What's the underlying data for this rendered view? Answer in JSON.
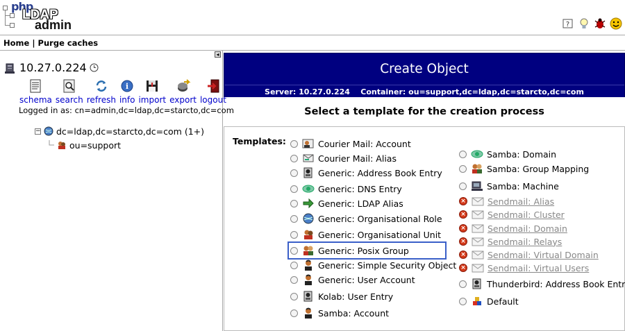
{
  "header": {
    "logo": {
      "php": "php",
      "ldap": "LDAP",
      "admin": "admin"
    },
    "icons": [
      "help-icon",
      "lightbulb-icon",
      "bug-icon",
      "smiley-icon"
    ]
  },
  "menubar": {
    "home": "Home",
    "separator": "|",
    "purge": "Purge caches"
  },
  "left": {
    "collapse_glyph": "◂",
    "server": "10.27.0.224",
    "tools": [
      {
        "label": "schema"
      },
      {
        "label": "search"
      },
      {
        "label": "refresh"
      },
      {
        "label": "info"
      },
      {
        "label": "import"
      },
      {
        "label": "export"
      },
      {
        "label": "logout"
      }
    ],
    "logged_in": "Logged in as: cn=admin,dc=ldap,dc=starcto,dc=com",
    "tree": {
      "toggle": "−",
      "root": "dc=ldap,dc=starcto,dc=com (1+)",
      "child": "ou=support"
    }
  },
  "main": {
    "title": "Create Object",
    "server_label": "Server:",
    "server": "10.27.0.224",
    "container_label": "Container:",
    "container": "ou=support,dc=ldap,dc=starcto,dc=com",
    "select_prompt": "Select a template for the creation process",
    "templates_label": "Templates:",
    "col1": [
      {
        "label": "Courier Mail: Account",
        "icon": "mail-user-icon",
        "disabled": false
      },
      {
        "label": "Courier Mail: Alias",
        "icon": "mail-alias-icon",
        "disabled": false
      },
      {
        "label": "Generic: Address Book Entry",
        "icon": "address-book-icon",
        "disabled": false
      },
      {
        "label": "Generic: DNS Entry",
        "icon": "dns-icon",
        "disabled": false
      },
      {
        "label": "Generic: LDAP Alias",
        "icon": "arrow-right-icon",
        "disabled": false
      },
      {
        "label": "Generic: Organisational Role",
        "icon": "globe-icon",
        "disabled": false
      },
      {
        "label": "Generic: Organisational Unit",
        "icon": "ou-icon",
        "disabled": false
      },
      {
        "label": "Generic: Posix Group",
        "icon": "group-icon",
        "disabled": false
      },
      {
        "label": "Generic: Simple Security Object",
        "icon": "user-icon",
        "disabled": false
      },
      {
        "label": "Generic: User Account",
        "icon": "user-icon",
        "disabled": false
      },
      {
        "label": "Kolab: User Entry",
        "icon": "address-book-icon",
        "disabled": false
      },
      {
        "label": "Samba: Account",
        "icon": "user-icon",
        "disabled": false
      }
    ],
    "col2": [
      {
        "label": "Samba: Domain",
        "icon": "dns-icon",
        "disabled": false
      },
      {
        "label": "Samba: Group Mapping",
        "icon": "group-icon",
        "disabled": false
      },
      {
        "label": "Samba: Machine",
        "icon": "computer-icon",
        "disabled": false
      },
      {
        "label": "Sendmail: Alias",
        "icon": "envelope-icon",
        "disabled": true
      },
      {
        "label": "Sendmail: Cluster",
        "icon": "envelope-icon",
        "disabled": true
      },
      {
        "label": "Sendmail: Domain",
        "icon": "envelope-icon",
        "disabled": true
      },
      {
        "label": "Sendmail: Relays",
        "icon": "envelope-icon",
        "disabled": true
      },
      {
        "label": "Sendmail: Virtual Domain",
        "icon": "envelope-icon",
        "disabled": true
      },
      {
        "label": "Sendmail: Virtual Users",
        "icon": "envelope-icon",
        "disabled": true
      },
      {
        "label": "Thunderbird: Address Book Entry",
        "icon": "address-book-icon",
        "disabled": false
      },
      {
        "label": "Default",
        "icon": "default-icon",
        "disabled": false
      }
    ]
  },
  "colors": {
    "title_bg": "#000080",
    "link": "#0000cc",
    "highlight": "#3a5fc8",
    "disabled_icon": "#d43a1a"
  }
}
